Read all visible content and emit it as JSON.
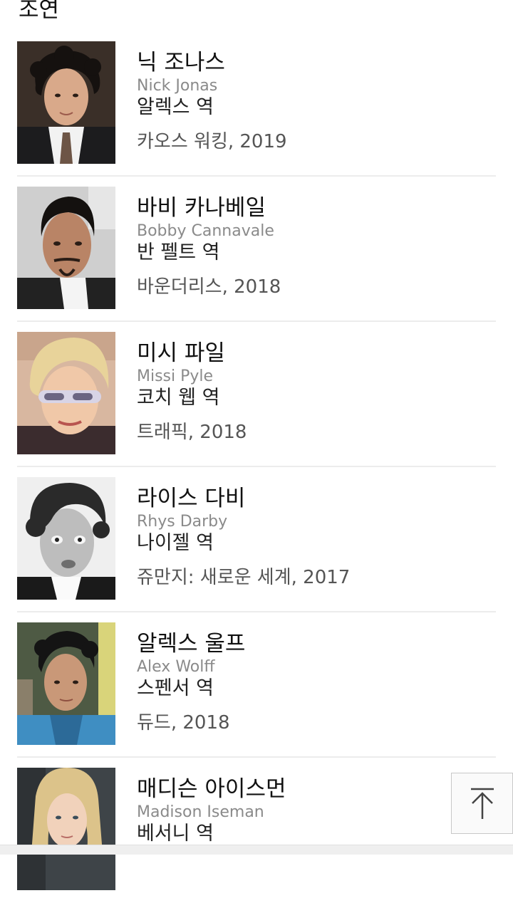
{
  "section": {
    "title": "조연"
  },
  "cast": [
    {
      "name": "닉 조나스",
      "name_en": "Nick Jonas",
      "role": "알렉스 역",
      "work": "카오스 워킹, 2019"
    },
    {
      "name": "바비 카나베일",
      "name_en": "Bobby Cannavale",
      "role": "반 펠트 역",
      "work": "바운더리스, 2018"
    },
    {
      "name": "미시 파일",
      "name_en": "Missi Pyle",
      "role": "코치 웹 역",
      "work": "트래픽, 2018"
    },
    {
      "name": "라이스 다비",
      "name_en": "Rhys Darby",
      "role": "나이젤 역",
      "work": "쥬만지: 새로운 세계, 2017"
    },
    {
      "name": "알렉스 울프",
      "name_en": "Alex Wolff",
      "role": "스펜서 역",
      "work": "듀드, 2018"
    },
    {
      "name": "매디슨 아이스먼",
      "name_en": "Madison Iseman",
      "role": "베서니 역",
      "work": ""
    }
  ],
  "icons": {
    "scroll_top": "arrow-up-icon"
  },
  "colors": {
    "name_en": "#8a8a8a",
    "work": "#555555",
    "divider": "#ececec"
  }
}
